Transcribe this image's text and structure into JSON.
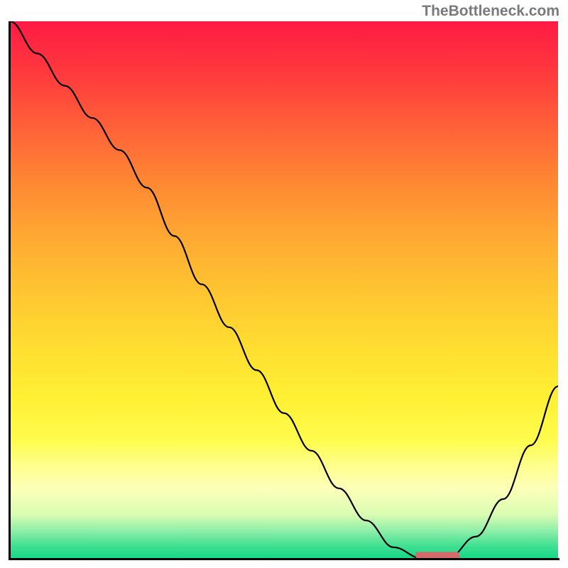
{
  "watermark": "TheBottleneck.com",
  "chart_data": {
    "type": "line",
    "title": "",
    "xlabel": "",
    "ylabel": "",
    "xlim": [
      0,
      100
    ],
    "ylim": [
      0,
      100
    ],
    "x": [
      0,
      5,
      10,
      15,
      20,
      25,
      30,
      35,
      40,
      45,
      50,
      55,
      60,
      65,
      70,
      75,
      80,
      85,
      90,
      95,
      100
    ],
    "values": [
      100,
      94,
      88,
      82,
      76,
      69,
      60,
      51,
      43,
      35,
      27,
      20,
      13,
      7,
      2,
      0,
      0,
      4,
      11,
      21,
      32
    ],
    "marker": {
      "x_start": 74,
      "x_end": 82,
      "y": 0.5
    },
    "background": "vertical-gradient red→orange→yellow→green"
  }
}
